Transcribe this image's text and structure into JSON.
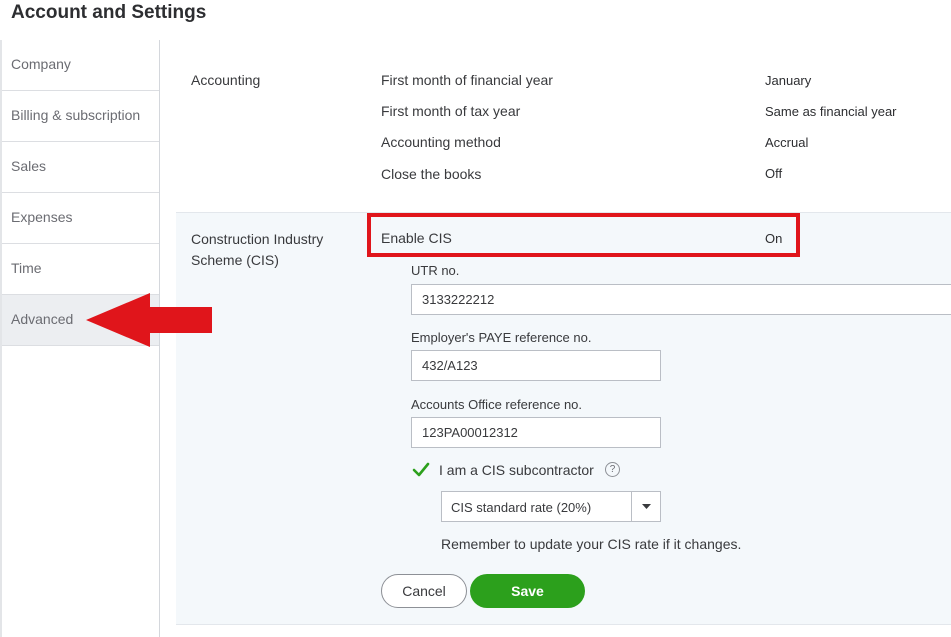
{
  "header": {
    "title": "Account and Settings"
  },
  "sidebar": {
    "items": [
      {
        "label": "Company"
      },
      {
        "label": "Billing & subscription"
      },
      {
        "label": "Sales"
      },
      {
        "label": "Expenses"
      },
      {
        "label": "Time"
      },
      {
        "label": "Advanced",
        "active": true
      }
    ]
  },
  "accounting": {
    "section_label": "Accounting",
    "rows": [
      {
        "label": "First month of financial year",
        "value": "January"
      },
      {
        "label": "First month of tax year",
        "value": "Same as financial year"
      },
      {
        "label": "Accounting method",
        "value": "Accrual"
      },
      {
        "label": "Close the books",
        "value": "Off"
      }
    ]
  },
  "cis": {
    "section_label": "Construction Industry Scheme (CIS)",
    "enable_label": "Enable CIS",
    "enable_value": "On",
    "utr_label": "UTR no.",
    "utr_value": "3133222212",
    "paye_label": "Employer's PAYE reference no.",
    "paye_value": "432/A123",
    "accounts_office_label": "Accounts Office reference no.",
    "accounts_office_value": "123PA00012312",
    "subcontractor_label": "I am a CIS subcontractor",
    "subcontractor_checked": true,
    "help_glyph": "?",
    "rate_selected": "CIS standard rate (20%)",
    "note": "Remember to update your CIS rate if it changes.",
    "cancel_label": "Cancel",
    "save_label": "Save"
  },
  "colors": {
    "highlight": "#e0151b",
    "save_button": "#2ca01c",
    "check": "#2ca01c",
    "panel_bg": "#f4f8fb"
  }
}
